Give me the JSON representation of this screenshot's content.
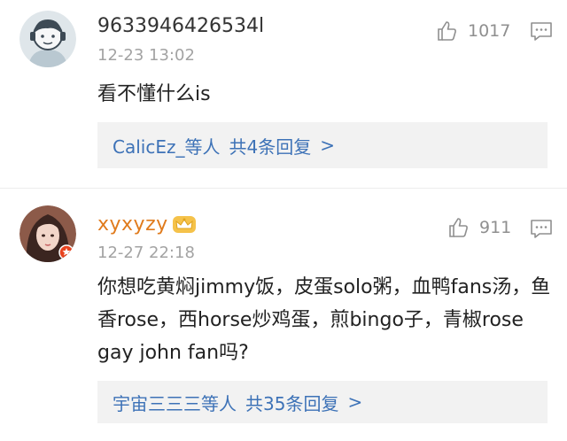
{
  "colors": {
    "username": "#333333",
    "vip_username": "#e07b1d",
    "timestamp": "#a3a3a3",
    "link": "#3d72b7",
    "reply_bg": "#f2f2f2"
  },
  "comments": [
    {
      "username": "9633946426534l",
      "timestamp": "12-23 13:02",
      "likes": "1017",
      "like_icon": "thumbs-up-icon",
      "more_icon": "comment-menu-icon",
      "content": "看不懂什么is",
      "replies": {
        "users": "CalicEz_等人",
        "count": "共4条回复",
        "chevron": ">"
      }
    },
    {
      "username": "xyxyzy",
      "badge_icon": "vip-crown-icon",
      "timestamp": "12-27 22:18",
      "likes": "911",
      "like_icon": "thumbs-up-icon",
      "more_icon": "comment-menu-icon",
      "content": "你想吃黄焖jimmy饭，皮蛋solo粥，血鸭fans汤，鱼香rose，西horse炒鸡蛋，煎bingo子，青椒rose gay john fan吗?",
      "replies": {
        "users": "宇宙三三三等人",
        "count": "共35条回复",
        "chevron": ">"
      }
    }
  ]
}
